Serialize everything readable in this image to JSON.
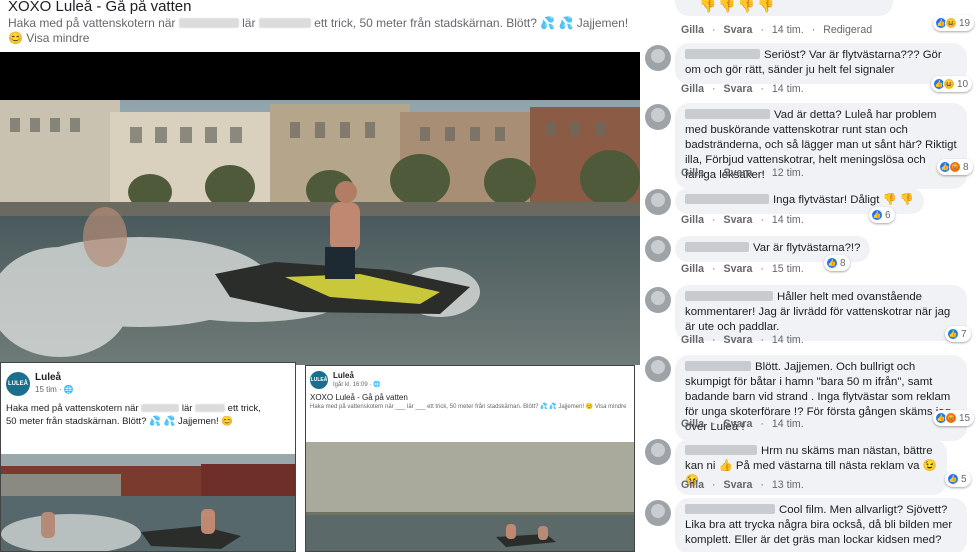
{
  "post": {
    "title": "XOXO Luleå - Gå på vatten",
    "text_1": "Haka med på vattenskotern när",
    "text_2": "lär",
    "text_3": "ett trick, 50 meter från stadskärnan. Blött? 💦 💦 Jajjemen! 😊",
    "see_less": "Visa mindre"
  },
  "inset1": {
    "page_name": "Luleå",
    "logo_text": "LULEÅ",
    "time": "15 tim · 🌐",
    "text_1": "Haka med på vattenskotern när",
    "text_2": "lär",
    "text_3": "ett trick,",
    "text_4": "50 meter från stadskärnan. Blött? 💦 💦 Jajjemen! 😊"
  },
  "inset2": {
    "page_name": "Luleå",
    "logo_text": "LULEÅ",
    "time": "Igår kl. 16:09 · 🌐",
    "title": "XOXO Luleå - Gå på vatten",
    "text": "Haka med på vattenskotern när ___ lär ___ ett trick, 50 meter från stadskärnan. Blött? 💦 💦 Jajjemen! 😊 Visa mindre"
  },
  "labels": {
    "like": "Gilla",
    "reply": "Svara",
    "edited": "Redigerad"
  },
  "comments": [
    {
      "text": "",
      "time": "14 tim.",
      "edited": true,
      "reactions": [
        "like",
        "haha"
      ],
      "count": "19"
    },
    {
      "text": "Seriöst? Var är flytvästarna??? Gör om och gör rätt, sänder ju helt fel signaler",
      "time": "14 tim.",
      "edited": false,
      "reactions": [
        "like",
        "haha"
      ],
      "count": "10"
    },
    {
      "text": "Vad är detta? Luleå har problem med buskörande vattenskotrar runt stan och badstränderna, och så lägger man ut sånt här? Riktigt illa, Förbjud vattenskotrar, helt meningslösa och farliga leksaker!",
      "time": "12 tim.",
      "edited": false,
      "reactions": [
        "like",
        "angry"
      ],
      "count": "8"
    },
    {
      "text": "Inga flytvästar! Dåligt 👎 👎",
      "time": "14 tim.",
      "edited": false,
      "reactions": [
        "like"
      ],
      "count": "6"
    },
    {
      "text": "Var är flytvästarna?!?",
      "time": "15 tim.",
      "edited": false,
      "reactions": [
        "like"
      ],
      "count": "8"
    },
    {
      "text": "Håller helt med ovanstående kommentarer! Jag är livrädd för vattenskotrar när jag är ute och paddlar.",
      "time": "14 tim.",
      "edited": false,
      "reactions": [
        "like"
      ],
      "count": "7"
    },
    {
      "text": "Blött. Jajjemen. Och bullrigt och skumpigt för båtar i hamn \"bara 50 m ifrån\", samt badande barn vid strand . Inga flytvästar som reklam för unga skoterförare !? För första gången skäms jag över Luleå !",
      "time": "14 tim.",
      "edited": false,
      "reactions": [
        "like",
        "angry"
      ],
      "count": "15"
    },
    {
      "text": "Hrm nu skäms man nästan, bättre kan ni 👍 På med västarna till nästa reklam va 😉 😉",
      "time": "13 tim.",
      "edited": false,
      "reactions": [
        "like"
      ],
      "count": "5"
    },
    {
      "text": "Cool film. Men allvarligt? Sjövett? Lika bra att trycka några bira också, då bli bilden mer komplett. Eller är det gräs man lockar kidsen med?",
      "time": "",
      "edited": false,
      "reactions": [],
      "count": ""
    }
  ]
}
